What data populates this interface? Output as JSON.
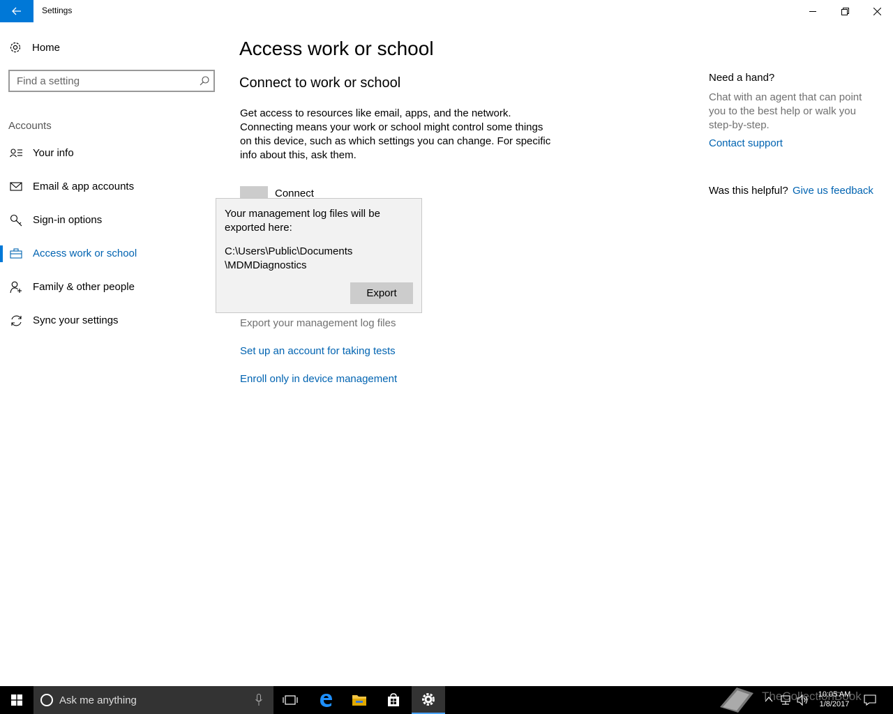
{
  "window": {
    "title": "Settings"
  },
  "sidebar": {
    "home_label": "Home",
    "search_placeholder": "Find a setting",
    "section_label": "Accounts",
    "items": [
      {
        "label": "Your info",
        "icon": "contact-card-icon",
        "selected": false
      },
      {
        "label": "Email & app accounts",
        "icon": "mail-icon",
        "selected": false
      },
      {
        "label": "Sign-in options",
        "icon": "key-icon",
        "selected": false
      },
      {
        "label": "Access work or school",
        "icon": "briefcase-icon",
        "selected": true
      },
      {
        "label": "Family & other people",
        "icon": "person-add-icon",
        "selected": false
      },
      {
        "label": "Sync your settings",
        "icon": "sync-icon",
        "selected": false
      }
    ]
  },
  "main": {
    "page_title": "Access work or school",
    "section_title": "Connect to work or school",
    "description": "Get access to resources like email, apps, and the network. Connecting means your work or school might control some things on this device, such as which settings you can change. For specific info about this, ask them.",
    "connect_label": "Connect",
    "popup": {
      "message": "Your management log files will be exported here:",
      "path_line1": "C:\\Users\\Public\\Documents",
      "path_line2": "\\MDMDiagnostics",
      "export_label": "Export"
    },
    "export_logs_label": "Export your management log files",
    "links": {
      "test_account": "Set up an account for taking tests",
      "enroll_mdm": "Enroll only in device management"
    }
  },
  "help": {
    "title": "Need a hand?",
    "text": "Chat with an agent that can point you to the best help or walk you step-by-step.",
    "contact_link": "Contact support",
    "helpful_question": "Was this helpful?",
    "feedback_link": "Give us feedback"
  },
  "taskbar": {
    "search_placeholder": "Ask me anything",
    "watermark": "TheCollectionBook",
    "time": "10:05 AM",
    "date": "1/8/2017"
  },
  "colors": {
    "accent": "#0078d7",
    "link": "#0063b1",
    "secondary_text": "#707070"
  }
}
